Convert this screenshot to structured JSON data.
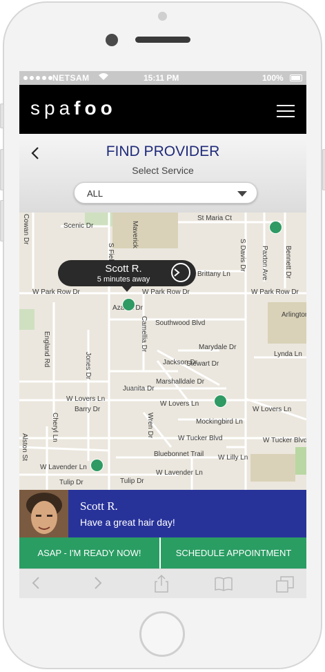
{
  "status": {
    "carrier": "NETSAM",
    "time": "15:11 PM",
    "battery": "100%"
  },
  "app": {
    "logo_light": "spa",
    "logo_bold": "foo"
  },
  "header": {
    "title": "FIND PROVIDER",
    "subtitle": "Select Service",
    "service_selected": "ALL"
  },
  "map": {
    "streets": [
      "Scenic Dr",
      "St Maria Ct",
      "Maverick",
      "S Fielder Rd",
      "S Davis Dr",
      "Paxton Ave",
      "Bennett Dr",
      "Brittany Ln",
      "W Park Row Dr",
      "W Park Row Dr",
      "W Park Row Dr",
      "Azalea Dr",
      "Arlington",
      "Camellia Dr",
      "Southwood Blvd",
      "England Rd",
      "Jones Dr",
      "Marydale Dr",
      "Lynda Ln",
      "Stewart Dr",
      "Jackson Dr",
      "Marshalldale Dr",
      "Juanita Dr",
      "W Lovers Ln",
      "W Lovers Ln",
      "W Lovers Ln",
      "Barry Dr",
      "Wren Dr",
      "Mockingbird Ln",
      "W Tucker Blvd",
      "W Tucker Blvd",
      "Bluebonnet Trail",
      "W Lilly Ln",
      "W Lavender Ln",
      "W Lavender Ln",
      "Tulip Dr",
      "Tulip Dr",
      "Cheryl Ln",
      "Alston St",
      "Cowan Dr"
    ],
    "popup": {
      "name": "Scott R.",
      "eta": "5 minutes away"
    }
  },
  "provider": {
    "name": "Scott R.",
    "message": "Have a great hair day!"
  },
  "actions": {
    "asap": "ASAP - I'M READY NOW!",
    "schedule": "SCHEDULE APPOINTMENT"
  },
  "icons": [
    "back-icon",
    "forward-icon",
    "share-icon",
    "bookmarks-icon",
    "tabs-icon",
    "menu-icon",
    "chevron-down-icon",
    "arrow-right-icon",
    "wifi-icon",
    "battery-icon"
  ],
  "colors": {
    "title": "#1f2a7a",
    "provider_bar": "#28339a",
    "action_green": "#2a9d63",
    "pin_green": "#2f9a63"
  }
}
